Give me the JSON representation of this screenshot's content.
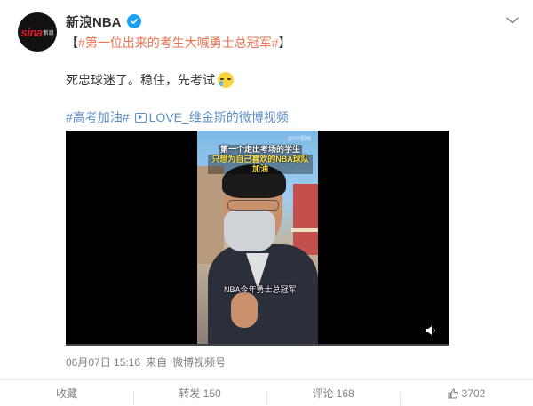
{
  "header": {
    "account_name": "新浪NBA",
    "avatar_text": "sina",
    "avatar_subtext": "新浪"
  },
  "post": {
    "topic_open": "【",
    "topic": "#第一位出来的考生大喊勇士总冠军#",
    "topic_close": "】",
    "text": "死忠球迷了。稳住，先考试",
    "tag": "#高考加油#",
    "video_link": "LOVE_维金斯的微博视频"
  },
  "video": {
    "caption_line1": "第一个走出考场的学生",
    "caption_line2": "只想为自己喜欢的NBA球队加油",
    "subtitle": "NBA今年勇士总冠军",
    "watermark": "@PP视频",
    "progress": 0.0
  },
  "meta": {
    "date": "06月07日 15:16",
    "source_prefix": "来自",
    "source": "微博视频号"
  },
  "actions": {
    "favorite": "收藏",
    "repost": "转发 150",
    "comment": "评论 168",
    "like": "3702"
  },
  "colors": {
    "topic": "#eb7350",
    "link": "#5d8ec2",
    "verified": "#1da1f2"
  }
}
